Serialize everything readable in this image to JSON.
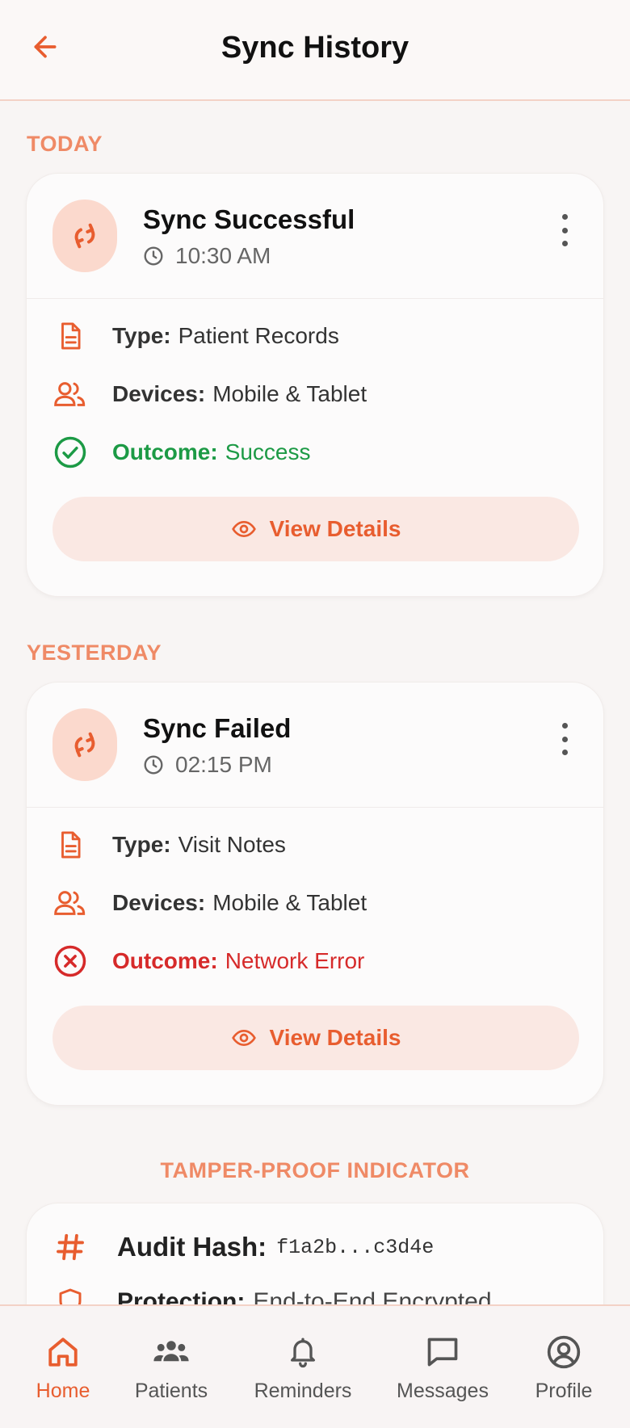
{
  "header": {
    "title": "Sync History"
  },
  "sections": {
    "today": "TODAY",
    "yesterday": "YESTERDAY",
    "tamper": "TAMPER-PROOF INDICATOR"
  },
  "cards": [
    {
      "title": "Sync Successful",
      "time": "10:30 AM",
      "type_label": "Type:",
      "type_value": "Patient Records",
      "devices_label": "Devices:",
      "devices_value": "Mobile & Tablet",
      "outcome_label": "Outcome:",
      "outcome_value": "Success",
      "button": "View Details"
    },
    {
      "title": "Sync Failed",
      "time": "02:15 PM",
      "type_label": "Type:",
      "type_value": "Visit Notes",
      "devices_label": "Devices:",
      "devices_value": "Mobile & Tablet",
      "outcome_label": "Outcome:",
      "outcome_value": "Network Error",
      "button": "View Details"
    }
  ],
  "tamper": {
    "hash_label": "Audit Hash:",
    "hash_value": "f1a2b...c3d4e",
    "protection_label": "Protection:",
    "protection_value": "End-to-End Encrypted"
  },
  "nav": [
    {
      "label": "Home",
      "icon": "home-icon",
      "active": true
    },
    {
      "label": "Patients",
      "icon": "users-icon",
      "active": false
    },
    {
      "label": "Reminders",
      "icon": "bell-icon",
      "active": false
    },
    {
      "label": "Messages",
      "icon": "chat-icon",
      "active": false
    },
    {
      "label": "Profile",
      "icon": "user-circle-icon",
      "active": false
    }
  ],
  "colors": {
    "accent": "#e85d2f",
    "section": "#ef8a66",
    "success": "#1c9a45",
    "error": "#d62a2a"
  }
}
